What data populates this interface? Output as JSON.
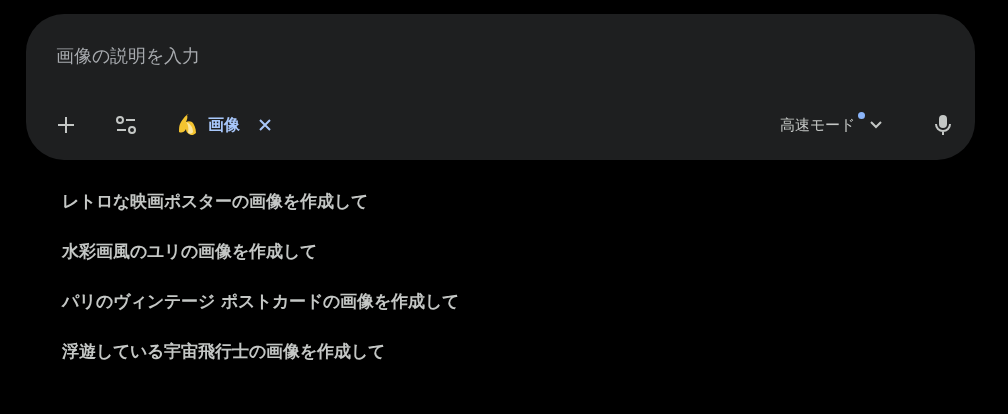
{
  "prompt": {
    "placeholder": "画像の説明を入力"
  },
  "toolbar": {
    "chip": {
      "label": "画像",
      "removable": true
    },
    "mode": {
      "label": "高速モード",
      "badge": true
    }
  },
  "suggestions": [
    "レトロな映画ポスターの画像を作成して",
    "水彩画風のユリの画像を作成して",
    "パリのヴィンテージ ポストカードの画像を作成して",
    "浮遊している宇宙飛行士の画像を作成して"
  ]
}
